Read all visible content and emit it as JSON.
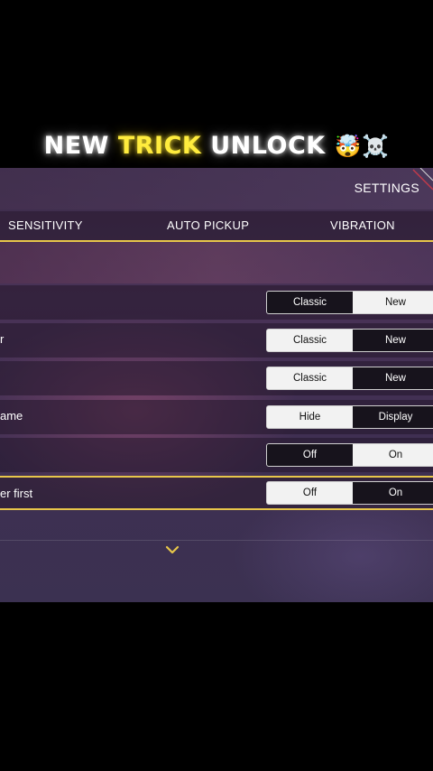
{
  "headline": {
    "part1": "NEW ",
    "highlight": "TRICK",
    "part2": " UNLOCK ",
    "emoji": "🤯☠️",
    "highlight_color": "#ffec3d"
  },
  "header": {
    "title": "SETTINGS"
  },
  "tabs": [
    {
      "label": "SENSITIVITY"
    },
    {
      "label": "AUTO PICKUP"
    },
    {
      "label": "VIBRATION"
    }
  ],
  "rows": [
    {
      "label": "",
      "options": [
        "Classic",
        "New"
      ],
      "selected": "Classic"
    },
    {
      "label": "r",
      "options": [
        "Classic",
        "New"
      ],
      "selected": "New"
    },
    {
      "label": "",
      "options": [
        "Classic",
        "New"
      ],
      "selected": "New"
    },
    {
      "label": "ame",
      "options": [
        "Hide",
        "Display"
      ],
      "selected": "Display"
    },
    {
      "label": "",
      "options": [
        "Off",
        "On"
      ],
      "selected": "Off"
    },
    {
      "label": "er first",
      "options": [
        "Off",
        "On"
      ],
      "selected": "On",
      "focused": true
    }
  ],
  "icons": {
    "expand": "chevron-down-icon",
    "corner": "corner-slash-icon"
  },
  "colors": {
    "accent": "#e7c64a",
    "background": "#000000",
    "toggle_active": "#17131c"
  }
}
